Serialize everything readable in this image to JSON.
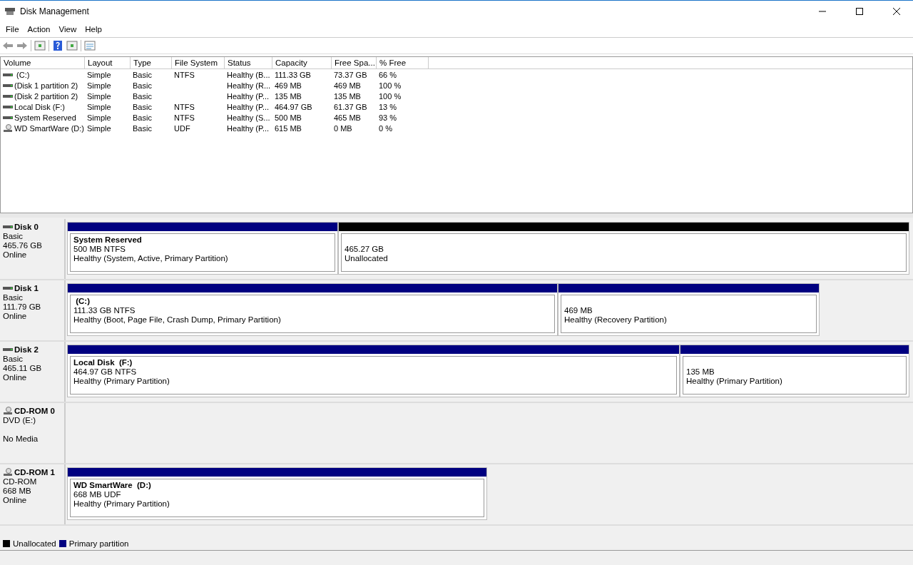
{
  "window": {
    "title": "Disk Management"
  },
  "menu": [
    "File",
    "Action",
    "View",
    "Help"
  ],
  "table": {
    "columns": [
      "Volume",
      "Layout",
      "Type",
      "File System",
      "Status",
      "Capacity",
      "Free Spa...",
      "% Free"
    ],
    "rows": [
      {
        "kind": "disk",
        "cells": [
          " (C:)",
          "Simple",
          "Basic",
          "NTFS",
          "Healthy (B...",
          "111.33 GB",
          "73.37 GB",
          "66 %"
        ]
      },
      {
        "kind": "disk",
        "cells": [
          "(Disk 1 partition 2)",
          "Simple",
          "Basic",
          "",
          "Healthy (R...",
          "469 MB",
          "469 MB",
          "100 %"
        ]
      },
      {
        "kind": "disk",
        "cells": [
          "(Disk 2 partition 2)",
          "Simple",
          "Basic",
          "",
          "Healthy (P...",
          "135 MB",
          "135 MB",
          "100 %"
        ]
      },
      {
        "kind": "disk",
        "cells": [
          "Local Disk (F:)",
          "Simple",
          "Basic",
          "NTFS",
          "Healthy (P...",
          "464.97 GB",
          "61.37 GB",
          "13 %"
        ]
      },
      {
        "kind": "disk",
        "cells": [
          "System Reserved",
          "Simple",
          "Basic",
          "NTFS",
          "Healthy (S...",
          "500 MB",
          "465 MB",
          "93 %"
        ]
      },
      {
        "kind": "optical",
        "cells": [
          "WD SmartWare (D:)",
          "Simple",
          "Basic",
          "UDF",
          "Healthy (P...",
          "615 MB",
          "0 MB",
          "0 %"
        ]
      }
    ]
  },
  "disks": [
    {
      "kind": "disk",
      "name": "Disk 0",
      "lines": [
        "Basic",
        "465.76 GB",
        "Online"
      ],
      "partitions": [
        {
          "kind": "primary",
          "title": "System Reserved",
          "size": "500 MB NTFS",
          "status": "Healthy (System, Active, Primary Partition)"
        },
        {
          "kind": "unallocated",
          "size": "465.27 GB",
          "status": "Unallocated"
        }
      ]
    },
    {
      "kind": "disk",
      "name": "Disk 1",
      "lines": [
        "Basic",
        "111.79 GB",
        "Online"
      ],
      "partitions": [
        {
          "kind": "primary",
          "title": " (C:)",
          "size": "111.33 GB NTFS",
          "status": "Healthy (Boot, Page File, Crash Dump, Primary Partition)"
        },
        {
          "kind": "primary",
          "size": "469 MB",
          "status": "Healthy (Recovery Partition)"
        }
      ]
    },
    {
      "kind": "disk",
      "name": "Disk 2",
      "lines": [
        "Basic",
        "465.11 GB",
        "Online"
      ],
      "partitions": [
        {
          "kind": "primary",
          "title": "Local Disk  (F:)",
          "size": "464.97 GB NTFS",
          "status": "Healthy (Primary Partition)"
        },
        {
          "kind": "primary",
          "size": "135 MB",
          "status": "Healthy (Primary Partition)"
        }
      ]
    },
    {
      "kind": "optical",
      "name": "CD-ROM 0",
      "lines": [
        "DVD (E:)",
        "No Media"
      ],
      "blank_line_before_last": true
    },
    {
      "kind": "optical",
      "name": "CD-ROM 1",
      "lines": [
        "CD-ROM",
        "668 MB",
        "Online"
      ],
      "partitions": [
        {
          "kind": "primary",
          "title": "WD SmartWare  (D:)",
          "size": "668 MB UDF",
          "status": "Healthy (Primary Partition)"
        }
      ]
    }
  ],
  "legend": [
    {
      "label": "Unallocated",
      "color": "#000000"
    },
    {
      "label": "Primary partition",
      "color": "#000080"
    }
  ]
}
